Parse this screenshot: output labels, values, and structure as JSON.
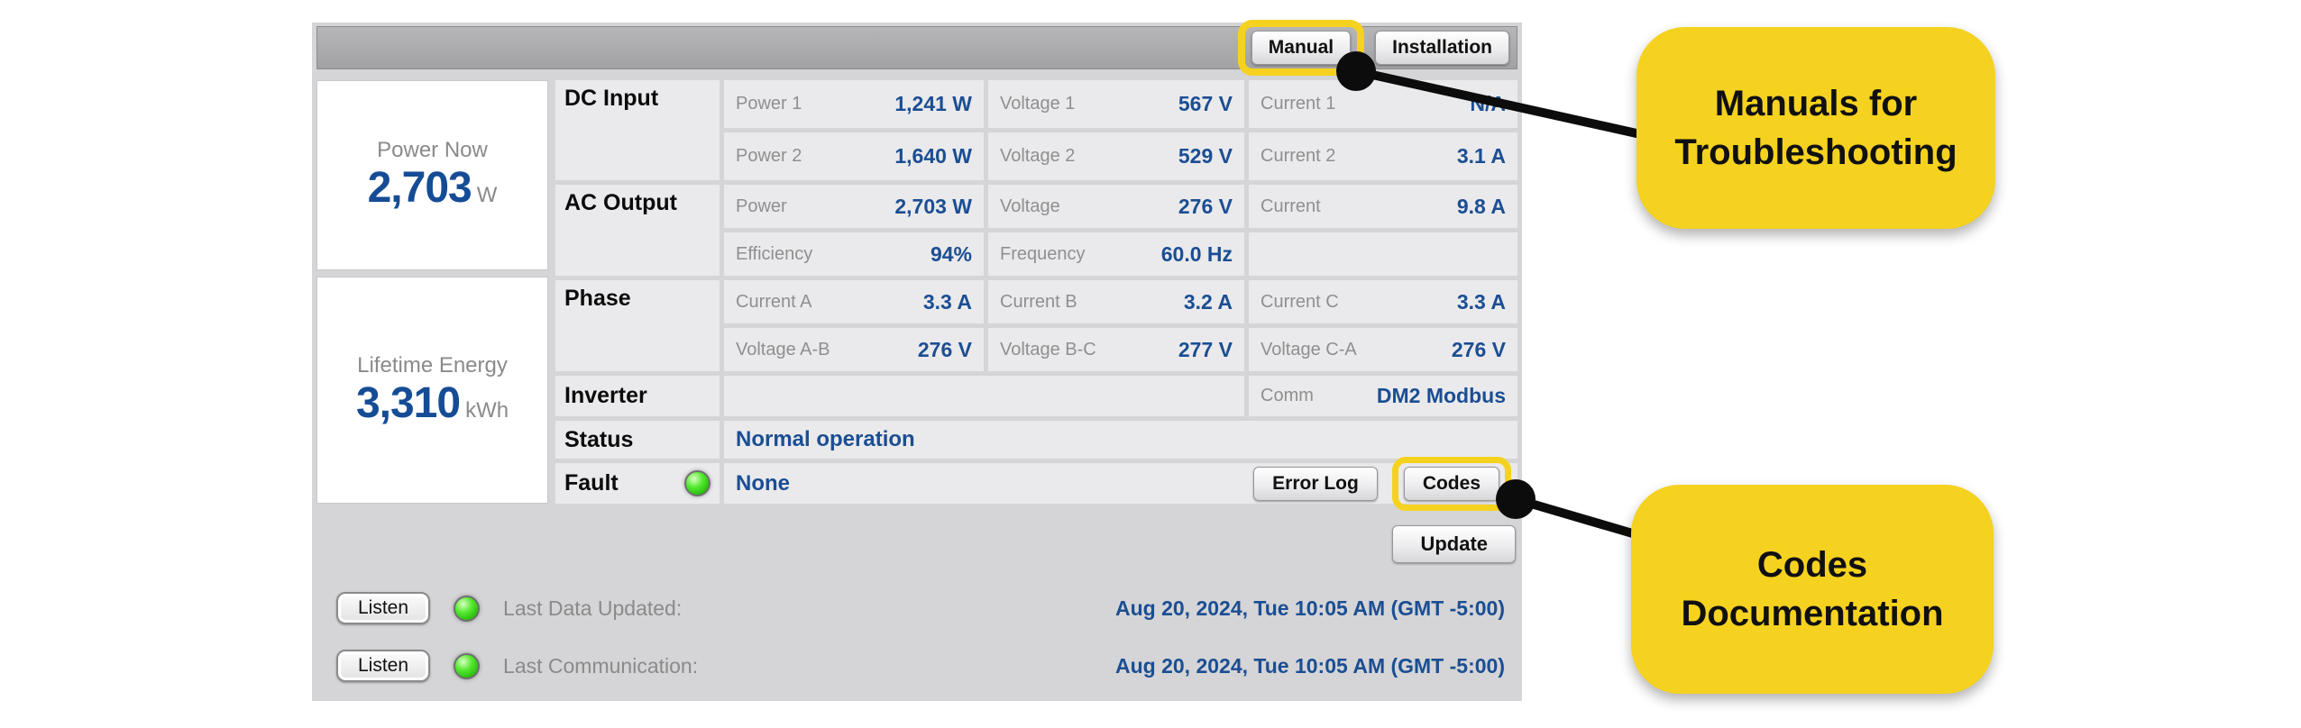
{
  "topbar": {
    "manual": "Manual",
    "installation": "Installation"
  },
  "summary": {
    "power_now": {
      "title": "Power Now",
      "value": "2,703",
      "unit": "W"
    },
    "lifetime_energy": {
      "title": "Lifetime Energy",
      "value": "3,310",
      "unit": "kWh"
    }
  },
  "sections": {
    "dc_input": "DC Input",
    "ac_output": "AC Output",
    "phase": "Phase",
    "inverter": "Inverter",
    "status": "Status",
    "fault": "Fault"
  },
  "rows": {
    "dc1": [
      {
        "label": "Power 1",
        "value": "1,241 W"
      },
      {
        "label": "Voltage 1",
        "value": "567 V"
      },
      {
        "label": "Current 1",
        "value": "N/A"
      }
    ],
    "dc2": [
      {
        "label": "Power 2",
        "value": "1,640 W"
      },
      {
        "label": "Voltage 2",
        "value": "529 V"
      },
      {
        "label": "Current 2",
        "value": "3.1 A"
      }
    ],
    "ac1": [
      {
        "label": "Power",
        "value": "2,703 W"
      },
      {
        "label": "Voltage",
        "value": "276 V"
      },
      {
        "label": "Current",
        "value": "9.8 A"
      }
    ],
    "ac2": [
      {
        "label": "Efficiency",
        "value": "94%"
      },
      {
        "label": "Frequency",
        "value": "60.0 Hz"
      }
    ],
    "phase1": [
      {
        "label": "Current A",
        "value": "3.3 A"
      },
      {
        "label": "Current B",
        "value": "3.2 A"
      },
      {
        "label": "Current C",
        "value": "3.3 A"
      }
    ],
    "phase2": [
      {
        "label": "Voltage A-B",
        "value": "276 V"
      },
      {
        "label": "Voltage B-C",
        "value": "277 V"
      },
      {
        "label": "Voltage C-A",
        "value": "276 V"
      }
    ],
    "comm": {
      "label": "Comm",
      "value": "DM2 Modbus"
    },
    "status_value": "Normal operation",
    "fault_value": "None"
  },
  "buttons": {
    "error_log": "Error Log",
    "codes": "Codes",
    "update": "Update",
    "listen": "Listen"
  },
  "footer": {
    "last_data": {
      "label": "Last Data Updated:",
      "value": "Aug 20, 2024, Tue 10:05 AM (GMT -5:00)"
    },
    "last_comm": {
      "label": "Last Communication:",
      "value": "Aug 20, 2024, Tue 10:05 AM (GMT -5:00)"
    }
  },
  "callouts": {
    "manual": "Manuals for\nTroubleshooting",
    "codes": "Codes\nDocumentation"
  },
  "colors": {
    "accent_yellow": "#F5D21F",
    "value_blue": "#1B4E93",
    "led_green": "#4CE527",
    "panel_gray": "#D5D5D7"
  }
}
